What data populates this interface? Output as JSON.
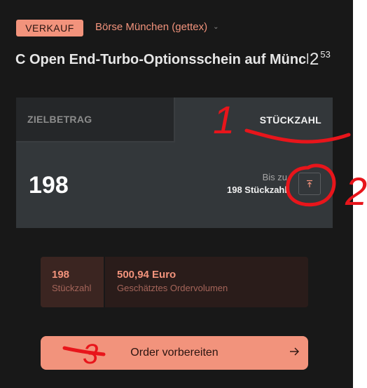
{
  "header": {
    "side": "VERKAUF",
    "exchange": "Börse München (gettex)",
    "instrument": "C Open End-Turbo-Optionsschein auf Münche",
    "price_main": "2",
    "price_decimals": "53"
  },
  "tabs": {
    "left": "ZIELBETRAG",
    "right": "STÜCKZAHL",
    "active": "right"
  },
  "quantity": {
    "value": "198",
    "max_label": "Bis zu",
    "max_value": "198 Stückzahl"
  },
  "summary": {
    "qty_value": "198",
    "qty_caption": "Stückzahl",
    "volume_value": "500,94 Euro",
    "volume_caption": "Geschätztes Ordervolumen"
  },
  "cta": {
    "label": "Order vorbereiten"
  },
  "annotations": {
    "n1": "1",
    "n2": "2",
    "n3": "3",
    "color": "#e8151b"
  },
  "colors": {
    "accent": "#f2937c",
    "background": "#181818",
    "box": "#33373a"
  },
  "icons": {
    "exchange_dropdown": "chevron-down-icon",
    "max": "arrow-to-top-icon",
    "cta": "arrow-right-icon"
  }
}
